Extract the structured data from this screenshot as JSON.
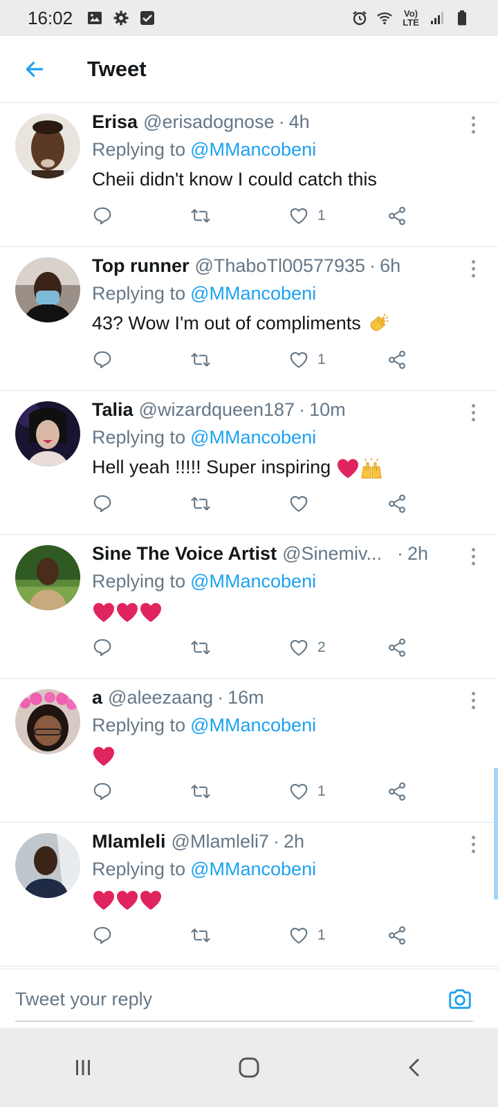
{
  "status_bar": {
    "time": "16:02",
    "network": "Vo) LTE",
    "icons": [
      "gallery-icon",
      "settings-icon",
      "checkbox-icon",
      "alarm-icon",
      "wifi-icon",
      "signal-icon",
      "battery-icon"
    ]
  },
  "header": {
    "title": "Tweet",
    "back_icon": "arrow-left-icon"
  },
  "colors": {
    "accent": "#1da1f2",
    "muted": "#657786",
    "divider": "#e1e8ed",
    "heart_emoji": "#e0245e"
  },
  "replies": [
    {
      "name": "Erisa",
      "handle": "@erisadognose",
      "time": "4h",
      "replying_label": "Replying to",
      "replying_to": "@MMancobeni",
      "text": "Cheii didn't know I could catch this",
      "emoji": [],
      "likes": "1"
    },
    {
      "name": "Top runner",
      "handle": "@ThaboTl00577935",
      "time": "6h",
      "replying_label": "Replying to",
      "replying_to": "@MMancobeni",
      "text": "43? Wow I'm out of compliments",
      "emoji": [
        "clapping-hands-emoji"
      ],
      "likes": "1"
    },
    {
      "name": "Talia",
      "handle": "@wizardqueen187",
      "time": "10m",
      "replying_label": "Replying to",
      "replying_to": "@MMancobeni",
      "text": "Hell yeah !!!!! Super inspiring",
      "emoji": [
        "red-heart-emoji",
        "raising-hands-emoji"
      ],
      "likes": ""
    },
    {
      "name": "Sine The Voice Artist",
      "handle": "@Sinemiv...",
      "time": "2h",
      "replying_label": "Replying to",
      "replying_to": "@MMancobeni",
      "text": "",
      "emoji": [
        "red-heart-emoji",
        "red-heart-emoji",
        "red-heart-emoji"
      ],
      "likes": "2"
    },
    {
      "name": "a",
      "handle": "@aleezaang",
      "time": "16m",
      "replying_label": "Replying to",
      "replying_to": "@MMancobeni",
      "text": "",
      "emoji": [
        "red-heart-emoji"
      ],
      "likes": "1"
    },
    {
      "name": "Mlamleli",
      "handle": "@Mlamleli7",
      "time": "2h",
      "replying_label": "Replying to",
      "replying_to": "@MMancobeni",
      "text": "",
      "emoji": [
        "red-heart-emoji",
        "red-heart-emoji",
        "red-heart-emoji"
      ],
      "likes": "1"
    }
  ],
  "composer": {
    "placeholder": "Tweet your reply",
    "camera_icon": "camera-icon"
  },
  "nav_bar": {
    "buttons": [
      "recents-icon",
      "home-icon",
      "back-icon"
    ]
  }
}
